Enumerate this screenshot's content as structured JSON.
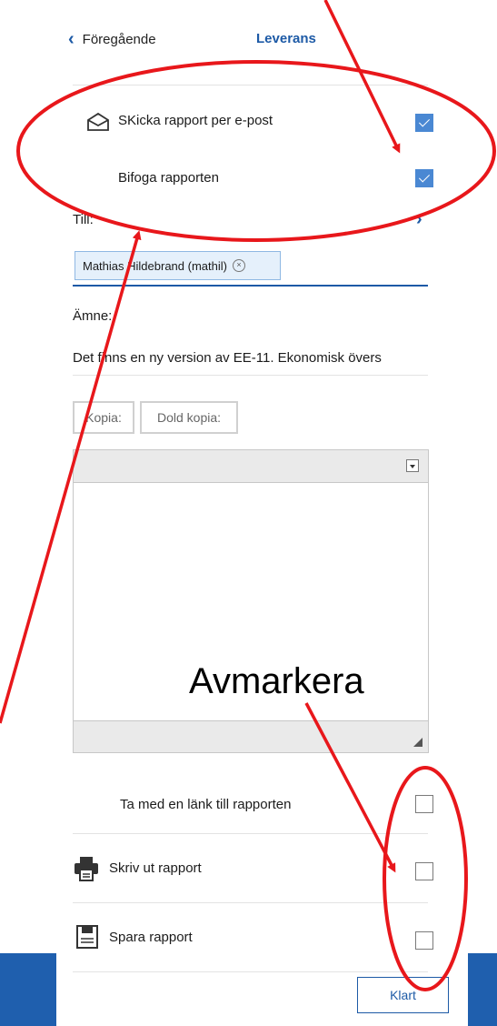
{
  "header": {
    "back_label": "Föregående",
    "title": "Leverans"
  },
  "email": {
    "send_label": "SKicka rapport per e-post",
    "send_checked": true,
    "attach_label": "Bifoga rapporten",
    "attach_checked": true
  },
  "to": {
    "label": "Till:",
    "recipient": "Mathias Hildebrand (mathil)"
  },
  "subject": {
    "label": "Ämne:",
    "value": "Det finns en ny version av EE-11. Ekonomisk övers"
  },
  "cc_buttons": {
    "cc": "Kopia:",
    "bcc": "Dold kopia:"
  },
  "options": {
    "include_link_label": "Ta med en länk till rapporten",
    "include_link_checked": false,
    "print_label": "Skriv ut rapport",
    "print_checked": false,
    "save_label": "Spara rapport",
    "save_checked": false
  },
  "footer": {
    "done_label": "Klart"
  },
  "annotation": {
    "text": "Avmarkera",
    "color": "#e8171b"
  },
  "colors": {
    "accent": "#1d5aa6",
    "checkbox_checked": "#4a88d3",
    "band": "#1f5fae"
  }
}
